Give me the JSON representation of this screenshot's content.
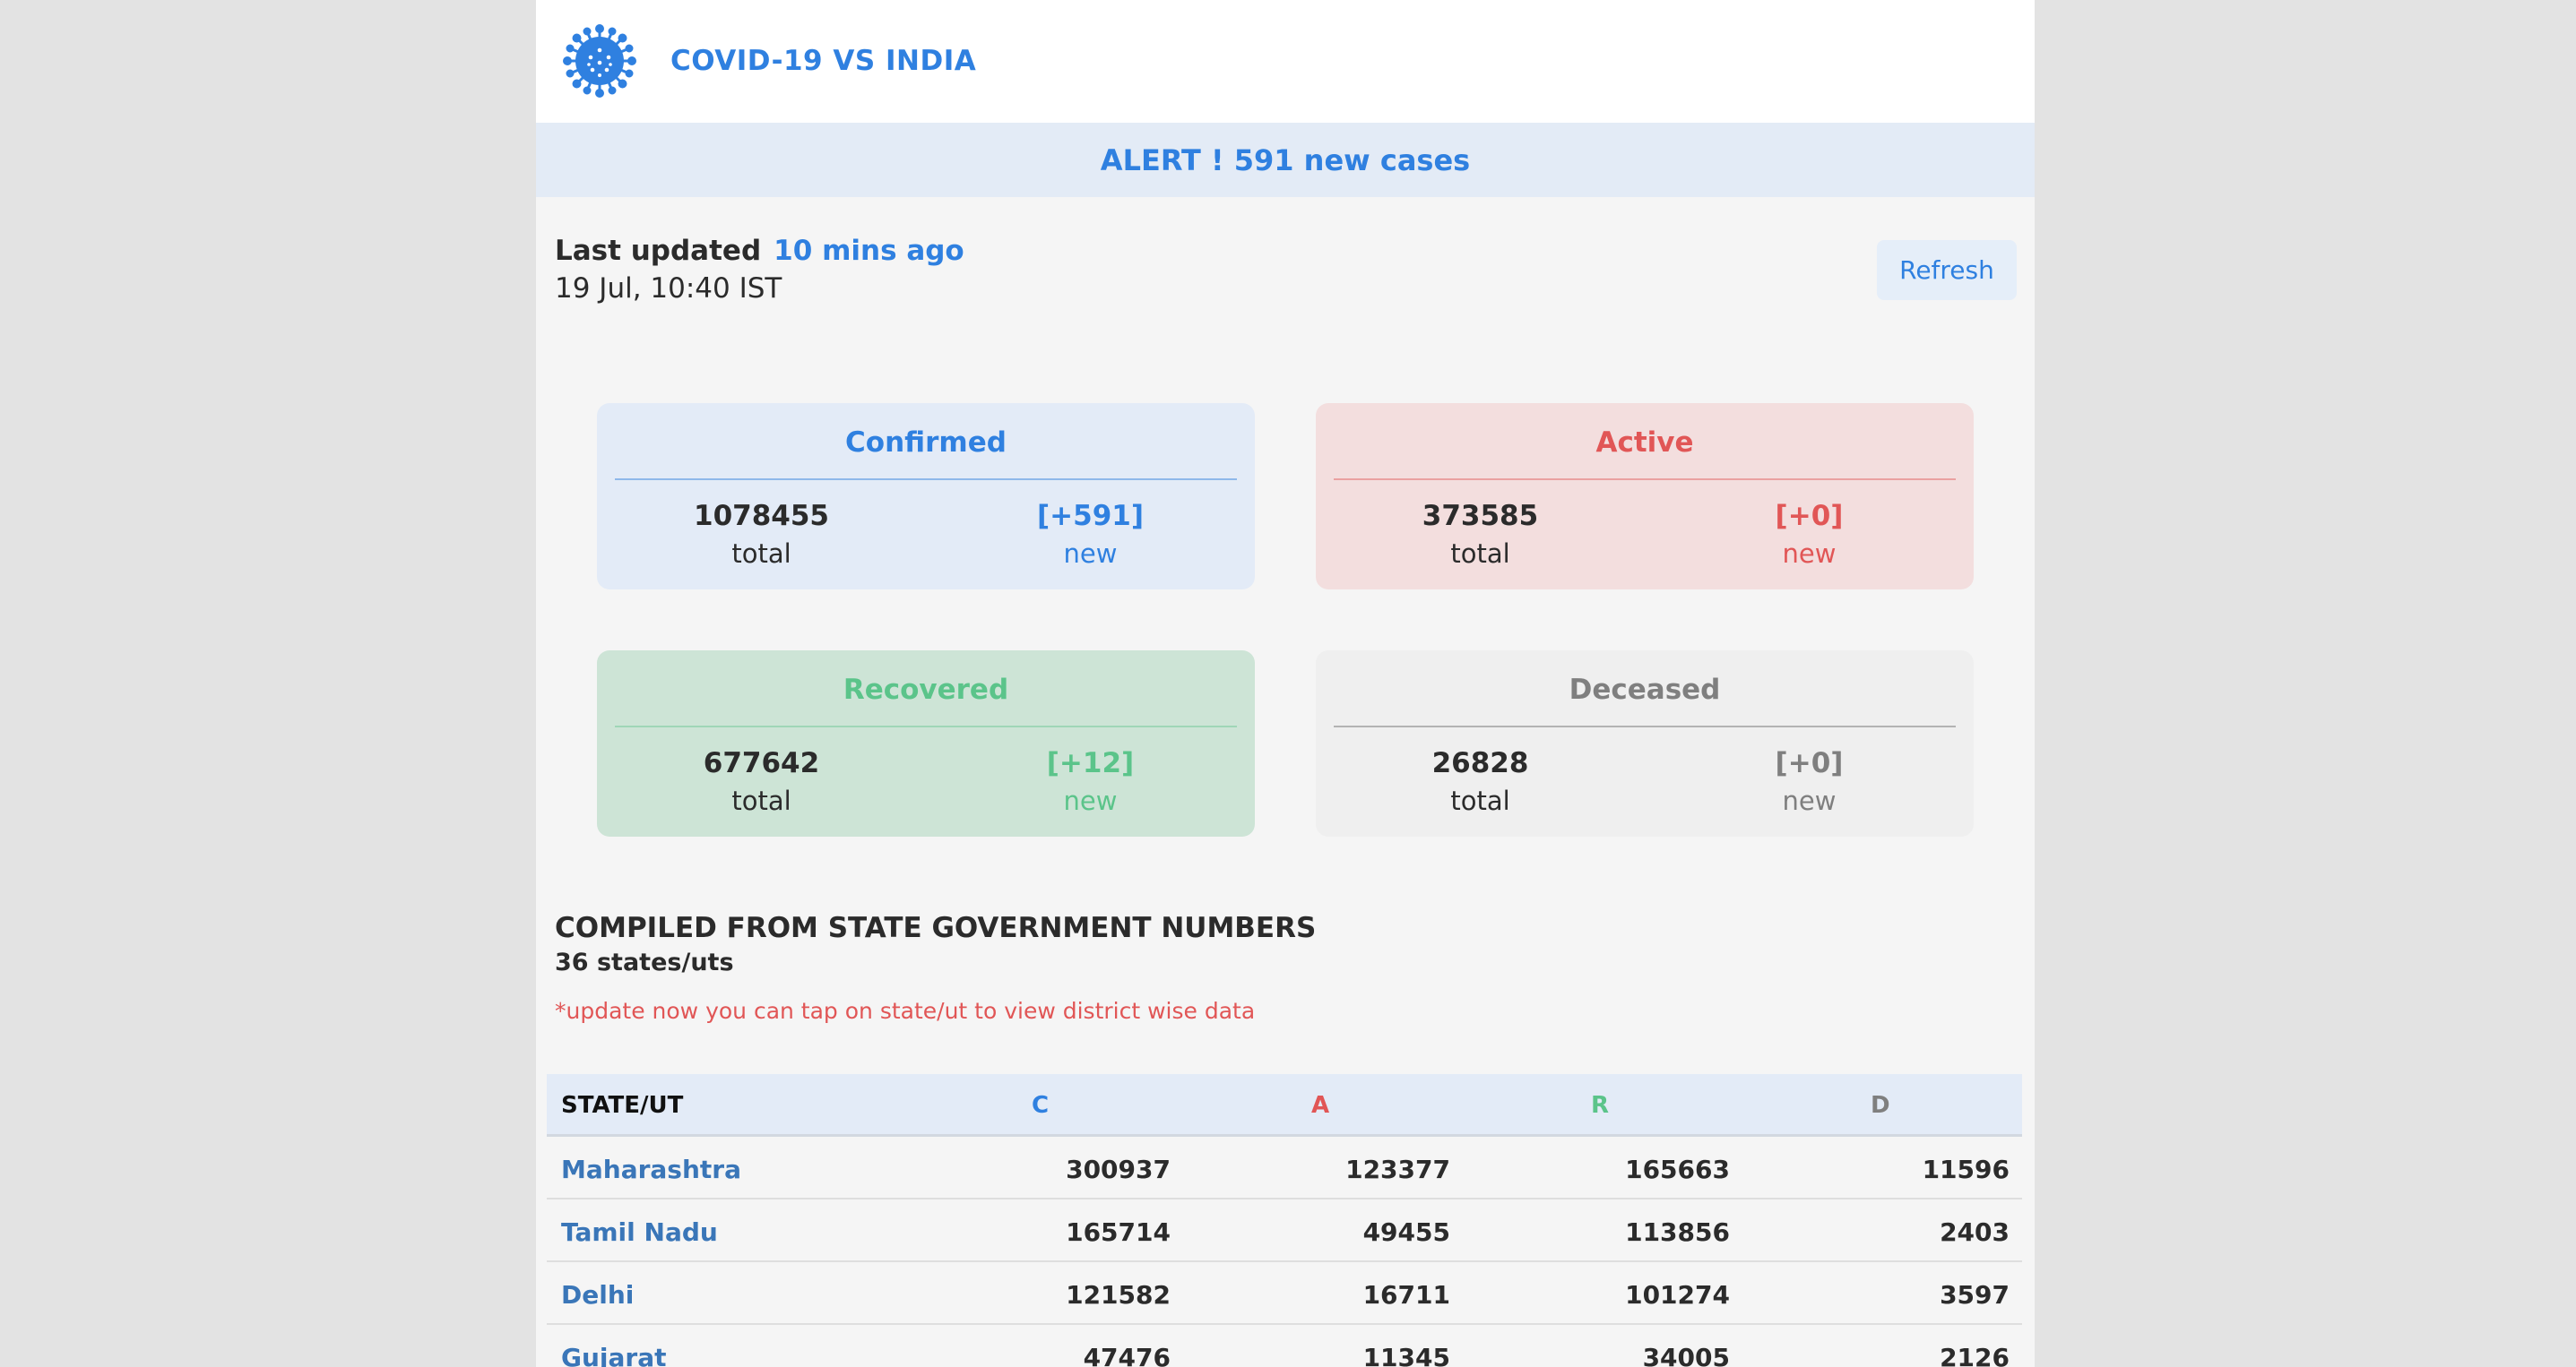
{
  "header": {
    "title": "COVID-19 VS INDIA",
    "logo_icon": "virus-icon"
  },
  "alert": {
    "text": "ALERT ! 591 new cases"
  },
  "updated": {
    "label": "Last updated",
    "ago": "10 mins ago",
    "date": "19 Jul, 10:40 IST",
    "refresh_label": "Refresh"
  },
  "cards": {
    "confirmed": {
      "title": "Confirmed",
      "total": "1078455",
      "total_label": "total",
      "new": "[+591]",
      "new_label": "new"
    },
    "active": {
      "title": "Active",
      "total": "373585",
      "total_label": "total",
      "new": "[+0]",
      "new_label": "new"
    },
    "recovered": {
      "title": "Recovered",
      "total": "677642",
      "total_label": "total",
      "new": "[+12]",
      "new_label": "new"
    },
    "deceased": {
      "title": "Deceased",
      "total": "26828",
      "total_label": "total",
      "new": "[+0]",
      "new_label": "new"
    }
  },
  "section": {
    "title": "COMPILED FROM STATE GOVERNMENT NUMBERS",
    "subtitle": "36 states/uts",
    "note": "*update now you can tap on state/ut to view district wise data"
  },
  "table": {
    "headers": [
      "STATE/UT",
      "C",
      "A",
      "R",
      "D"
    ],
    "rows": [
      {
        "state": "Maharashtra",
        "c": "300937",
        "a": "123377",
        "r": "165663",
        "d": "11596"
      },
      {
        "state": "Tamil Nadu",
        "c": "165714",
        "a": "49455",
        "r": "113856",
        "d": "2403"
      },
      {
        "state": "Delhi",
        "c": "121582",
        "a": "16711",
        "r": "101274",
        "d": "3597"
      },
      {
        "state": "Gujarat",
        "c": "47476",
        "a": "11345",
        "r": "34005",
        "d": "2126"
      }
    ]
  },
  "colors": {
    "blue": "#2f80e0",
    "red": "#e15656",
    "green": "#5bc48a",
    "grey": "#7f7f7f"
  }
}
